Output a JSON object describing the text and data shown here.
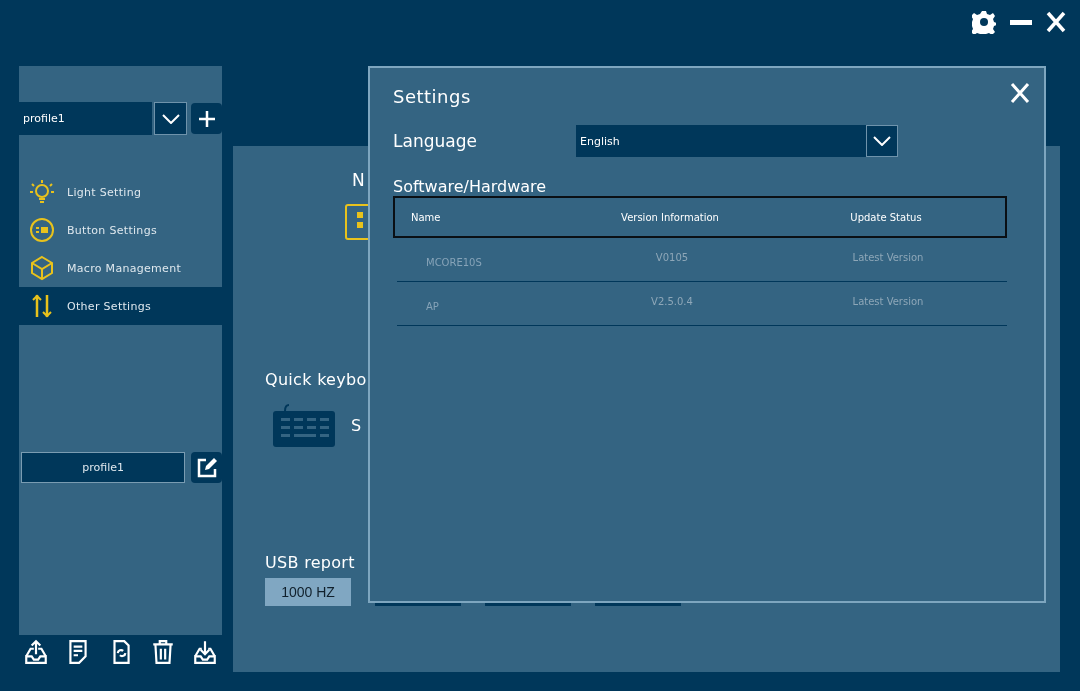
{
  "sidebar": {
    "profile_select": {
      "value": "profile1"
    },
    "nav_items": [
      {
        "label": "Light Setting",
        "selected": false
      },
      {
        "label": "Button Settings",
        "selected": false
      },
      {
        "label": "Macro Management",
        "selected": false
      },
      {
        "label": "Other Settings",
        "selected": true
      }
    ],
    "profile_name": {
      "value": "profile1"
    }
  },
  "main": {
    "heading": "N",
    "quick_keyboard": {
      "title": "Quick keybo",
      "option": "S"
    },
    "usb_report": {
      "title": "USB report",
      "rate_options": [
        {
          "label": "1000 HZ",
          "selected": true
        },
        {
          "selected": false
        },
        {
          "selected": false
        },
        {
          "selected": false
        }
      ]
    }
  },
  "settings_dialog": {
    "title": "Settings",
    "language": {
      "label": "Language",
      "value": "English"
    },
    "section": "Software/Hardware",
    "table": {
      "columns": [
        "Name",
        "Version Information",
        "Update Status"
      ],
      "rows": [
        [
          "MCORE10S",
          "V0105",
          "Latest Version"
        ],
        [
          "AP",
          "V2.5.0.4",
          "Latest Version"
        ]
      ]
    }
  }
}
